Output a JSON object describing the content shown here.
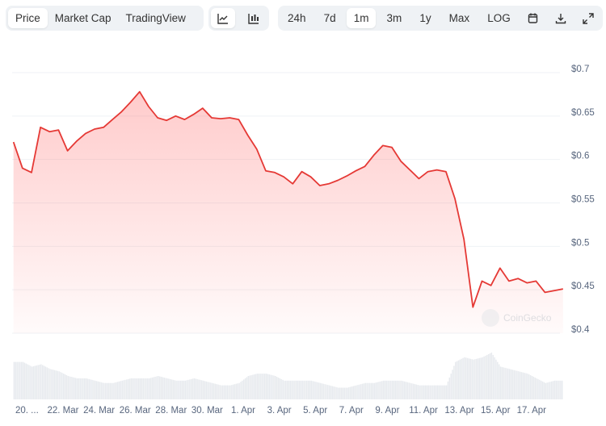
{
  "toolbar": {
    "view_tabs": [
      {
        "label": "Price",
        "active": true
      },
      {
        "label": "Market Cap",
        "active": false
      },
      {
        "label": "TradingView",
        "active": false
      }
    ],
    "chart_types": [
      {
        "icon": "line-chart-icon",
        "active": true
      },
      {
        "icon": "candlestick-chart-icon",
        "active": false
      }
    ],
    "ranges": [
      {
        "label": "24h",
        "active": false
      },
      {
        "label": "7d",
        "active": false
      },
      {
        "label": "1m",
        "active": true
      },
      {
        "label": "3m",
        "active": false
      },
      {
        "label": "1y",
        "active": false
      },
      {
        "label": "Max",
        "active": false
      },
      {
        "label": "LOG",
        "active": false
      }
    ],
    "actions": [
      {
        "icon": "calendar-icon"
      },
      {
        "icon": "download-icon"
      },
      {
        "icon": "fullscreen-icon"
      }
    ]
  },
  "watermark": "CoinGecko",
  "colors": {
    "line": "#e53935",
    "fill": "#ff6b6b",
    "volume": "#e7eaee",
    "grid": "#eff2f5"
  },
  "chart_data": {
    "type": "line",
    "title": "",
    "xlabel": "",
    "ylabel": "",
    "ylim": [
      0.4,
      0.7
    ],
    "yticks": [
      "$0.4",
      "$0.45",
      "$0.5",
      "$0.55",
      "$0.6",
      "$0.65",
      "$0.7"
    ],
    "ytick_values": [
      0.4,
      0.45,
      0.5,
      0.55,
      0.6,
      0.65,
      0.7
    ],
    "xticks": [
      "20. ...",
      "22. Mar",
      "24. Mar",
      "26. Mar",
      "28. Mar",
      "30. Mar",
      "1. Apr",
      "3. Apr",
      "5. Apr",
      "7. Apr",
      "9. Apr",
      "11. Apr",
      "13. Apr",
      "15. Apr",
      "17. Apr"
    ],
    "xtick_dates": [
      "2024-03-20",
      "2024-03-22",
      "2024-03-24",
      "2024-03-26",
      "2024-03-28",
      "2024-03-30",
      "2024-04-01",
      "2024-04-03",
      "2024-04-05",
      "2024-04-07",
      "2024-04-09",
      "2024-04-11",
      "2024-04-13",
      "2024-04-15",
      "2024-04-17"
    ],
    "x_start": "2024-03-19T06:00",
    "x_step_hours": 12,
    "grid": true,
    "price": [
      0.62,
      0.59,
      0.585,
      0.637,
      0.632,
      0.634,
      0.61,
      0.621,
      0.63,
      0.635,
      0.637,
      0.646,
      0.655,
      0.666,
      0.678,
      0.661,
      0.648,
      0.645,
      0.65,
      0.646,
      0.652,
      0.659,
      0.648,
      0.647,
      0.648,
      0.646,
      0.628,
      0.612,
      0.587,
      0.585,
      0.58,
      0.572,
      0.586,
      0.58,
      0.57,
      0.572,
      0.576,
      0.581,
      0.587,
      0.592,
      0.605,
      0.616,
      0.614,
      0.598,
      0.588,
      0.578,
      0.586,
      0.588,
      0.586,
      0.555,
      0.508,
      0.43,
      0.46,
      0.455,
      0.475,
      0.46,
      0.463,
      0.458,
      0.46,
      0.447,
      0.449,
      0.451
    ],
    "volume_relative": [
      0.8,
      0.8,
      0.7,
      0.75,
      0.65,
      0.6,
      0.5,
      0.45,
      0.45,
      0.4,
      0.35,
      0.35,
      0.4,
      0.45,
      0.45,
      0.45,
      0.5,
      0.45,
      0.4,
      0.4,
      0.45,
      0.4,
      0.35,
      0.3,
      0.3,
      0.35,
      0.5,
      0.55,
      0.55,
      0.5,
      0.4,
      0.4,
      0.4,
      0.4,
      0.35,
      0.3,
      0.25,
      0.25,
      0.3,
      0.35,
      0.35,
      0.4,
      0.4,
      0.4,
      0.35,
      0.3,
      0.3,
      0.3,
      0.3,
      0.8,
      0.9,
      0.85,
      0.9,
      1.0,
      0.7,
      0.65,
      0.6,
      0.55,
      0.45,
      0.35,
      0.4,
      0.4
    ]
  }
}
